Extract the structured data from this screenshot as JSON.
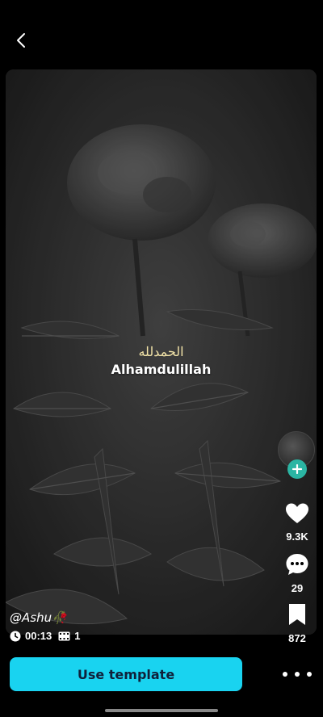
{
  "header": {
    "back_icon": "chevron-left-icon"
  },
  "video": {
    "caption_arabic": "الحمدلله",
    "caption_main": "Alhamdulillah"
  },
  "actions": {
    "like": {
      "icon": "heart-icon",
      "count": "9.3K"
    },
    "comment": {
      "icon": "comment-icon",
      "count": "29"
    },
    "save": {
      "icon": "bookmark-icon",
      "count": "872"
    },
    "follow_icon": "plus-icon"
  },
  "author": {
    "handle": "@Ashu🥀"
  },
  "meta": {
    "duration": "00:13",
    "clips": "1"
  },
  "footer": {
    "use_template_label": "Use template",
    "more_icon": "more-dots-icon"
  },
  "colors": {
    "accent": "#19d3f0",
    "follow": "#2bb5a3",
    "background": "#000000"
  }
}
